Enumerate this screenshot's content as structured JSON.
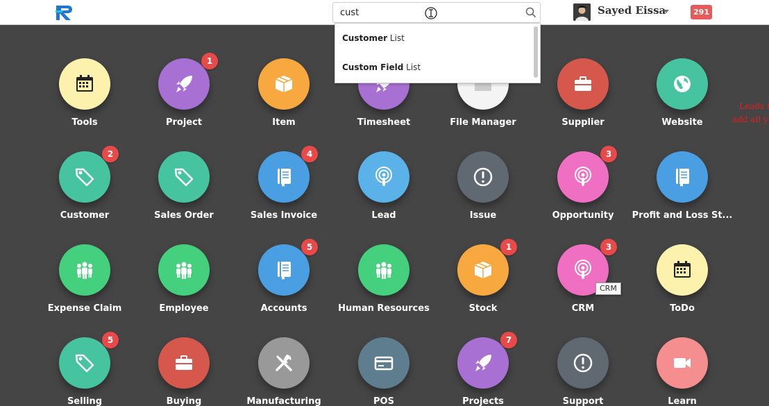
{
  "navbar": {
    "search_value": "cust",
    "user_name": "Sayed Eissa",
    "notification_count": "291"
  },
  "search_results": [
    {
      "match": "Custom",
      "match_suffix": "er",
      "rest": " List",
      "label": "Customer List"
    },
    {
      "match": "Custom",
      "match_suffix": " Field",
      "rest": " List",
      "label": "Custom Field List"
    }
  ],
  "modules": [
    {
      "label": "Tools",
      "icon": "calendar-icon",
      "color": "#fdf2ad",
      "badge": ""
    },
    {
      "label": "Project",
      "icon": "rocket-icon",
      "color": "#a870d3",
      "badge": "1"
    },
    {
      "label": "Item",
      "icon": "box-icon",
      "color": "#f7a940",
      "badge": ""
    },
    {
      "label": "Timesheet",
      "icon": "rocket-icon",
      "color": "#a870d3",
      "badge": ""
    },
    {
      "label": "File Manager",
      "icon": "folder-icon",
      "color": "#f4f4f4",
      "badge": ""
    },
    {
      "label": "Supplier",
      "icon": "briefcase-icon",
      "color": "#d6574c",
      "badge": ""
    },
    {
      "label": "Website",
      "icon": "globe-icon",
      "color": "#46c49f",
      "badge": ""
    },
    {
      "label": "Customer",
      "icon": "tag-icon",
      "color": "#46c49f",
      "badge": "2"
    },
    {
      "label": "Sales Order",
      "icon": "tag-icon",
      "color": "#46c49f",
      "badge": ""
    },
    {
      "label": "Sales Invoice",
      "icon": "book-icon",
      "color": "#4a9fe2",
      "badge": "4"
    },
    {
      "label": "Lead",
      "icon": "podcast-icon",
      "color": "#5ab2e8",
      "badge": ""
    },
    {
      "label": "Issue",
      "icon": "alert-icon",
      "color": "#606872",
      "badge": ""
    },
    {
      "label": "Opportunity",
      "icon": "podcast-icon",
      "color": "#ef6fc2",
      "badge": "3"
    },
    {
      "label": "Profit and Loss St...",
      "icon": "book-icon",
      "color": "#4a9fe2",
      "badge": ""
    },
    {
      "label": "Expense Claim",
      "icon": "people-icon",
      "color": "#44d07c",
      "badge": ""
    },
    {
      "label": "Employee",
      "icon": "people-icon",
      "color": "#44d07c",
      "badge": ""
    },
    {
      "label": "Accounts",
      "icon": "book-icon",
      "color": "#4a9fe2",
      "badge": "5"
    },
    {
      "label": "Human Resources",
      "icon": "people-icon",
      "color": "#44d07c",
      "badge": ""
    },
    {
      "label": "Stock",
      "icon": "box-icon",
      "color": "#f7a940",
      "badge": "1"
    },
    {
      "label": "CRM",
      "icon": "podcast-icon",
      "color": "#ef6fc2",
      "badge": "3"
    },
    {
      "label": "ToDo",
      "icon": "calendar-icon",
      "color": "#fdf2ad",
      "badge": ""
    },
    {
      "label": "Selling",
      "icon": "tag-icon",
      "color": "#46c49f",
      "badge": "5"
    },
    {
      "label": "Buying",
      "icon": "briefcase-icon",
      "color": "#d6574c",
      "badge": ""
    },
    {
      "label": "Manufacturing",
      "icon": "tools-icon",
      "color": "#999999",
      "badge": ""
    },
    {
      "label": "POS",
      "icon": "card-icon",
      "color": "#5e7e8f",
      "badge": ""
    },
    {
      "label": "Projects",
      "icon": "rocket-icon",
      "color": "#a870d3",
      "badge": "7"
    },
    {
      "label": "Support",
      "icon": "alert-icon",
      "color": "#606872",
      "badge": ""
    },
    {
      "label": "Learn",
      "icon": "video-icon",
      "color": "#f58e8e",
      "badge": ""
    }
  ],
  "tooltip": "CRM",
  "side_note": {
    "line1": "Leads f",
    "line2": "add all y"
  }
}
